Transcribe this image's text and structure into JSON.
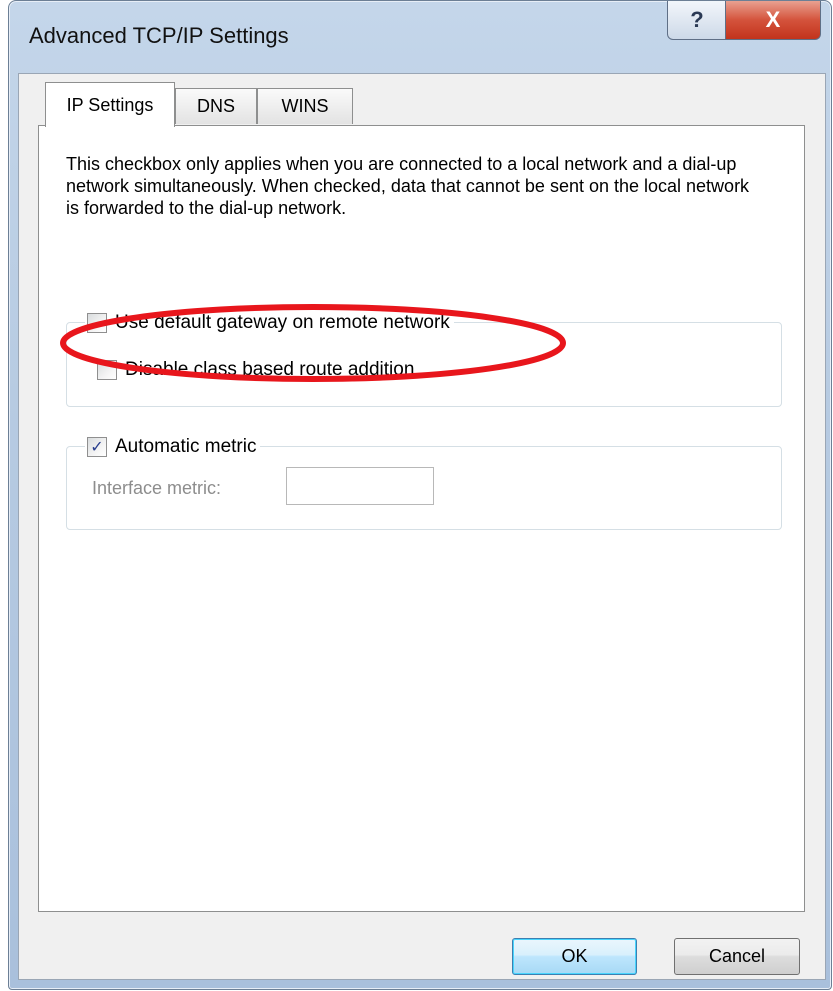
{
  "window": {
    "title": "Advanced TCP/IP Settings",
    "help_glyph": "?",
    "close_glyph": "X"
  },
  "tabs": [
    {
      "label": "IP Settings",
      "active": true
    },
    {
      "label": "DNS",
      "active": false
    },
    {
      "label": "WINS",
      "active": false
    }
  ],
  "description": "This checkbox only applies when you are connected to a local network and a dial-up network simultaneously.  When checked, data that cannot be sent on the local network is forwarded to the dial-up network.",
  "options": {
    "use_default_gateway": {
      "label": "Use default gateway on remote network",
      "checked": false
    },
    "disable_class_route": {
      "label": "Disable class based route addition",
      "checked": false
    },
    "automatic_metric": {
      "label": "Automatic metric",
      "checked": true,
      "check_glyph": "✓"
    }
  },
  "interface_metric": {
    "label": "Interface metric:",
    "value": ""
  },
  "buttons": {
    "ok": "OK",
    "cancel": "Cancel"
  },
  "colors": {
    "highlight": "#e8161c",
    "checkmark": "#2a3f8e"
  }
}
